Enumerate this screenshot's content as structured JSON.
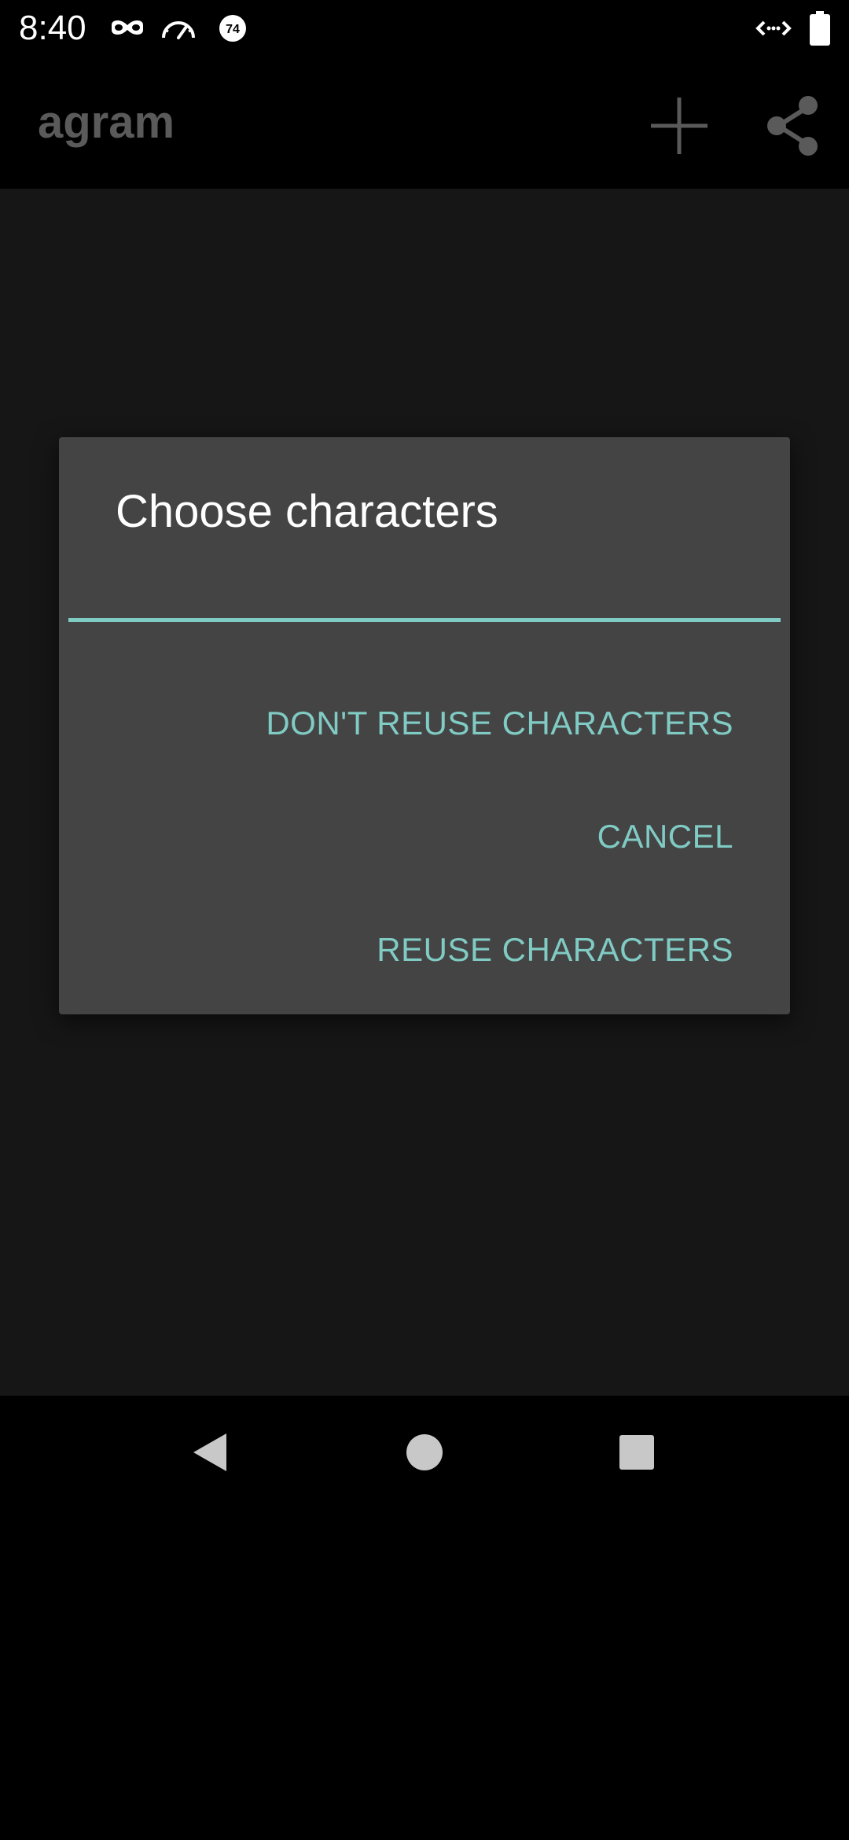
{
  "status_bar": {
    "time": "8:40",
    "icons_left": [
      "incognito-icon",
      "speedometer-icon",
      "badge-74-icon"
    ],
    "badge_text": "74",
    "icons_right": [
      "data-transfer-icon",
      "battery-icon"
    ]
  },
  "app_bar": {
    "title": "agram",
    "actions": [
      "add-icon",
      "share-icon"
    ]
  },
  "dialog": {
    "title": "Choose characters",
    "input_value": "",
    "buttons": {
      "dont_reuse": "DON'T REUSE CHARACTERS",
      "cancel": "CANCEL",
      "reuse": "REUSE CHARACTERS"
    }
  },
  "nav_bar": {
    "buttons": [
      "back-icon",
      "home-icon",
      "recents-icon"
    ]
  },
  "colors": {
    "accent": "#80cbc4",
    "dialog_bg": "#444444",
    "content_bg": "#161616",
    "app_title": "#5a5a5a"
  }
}
